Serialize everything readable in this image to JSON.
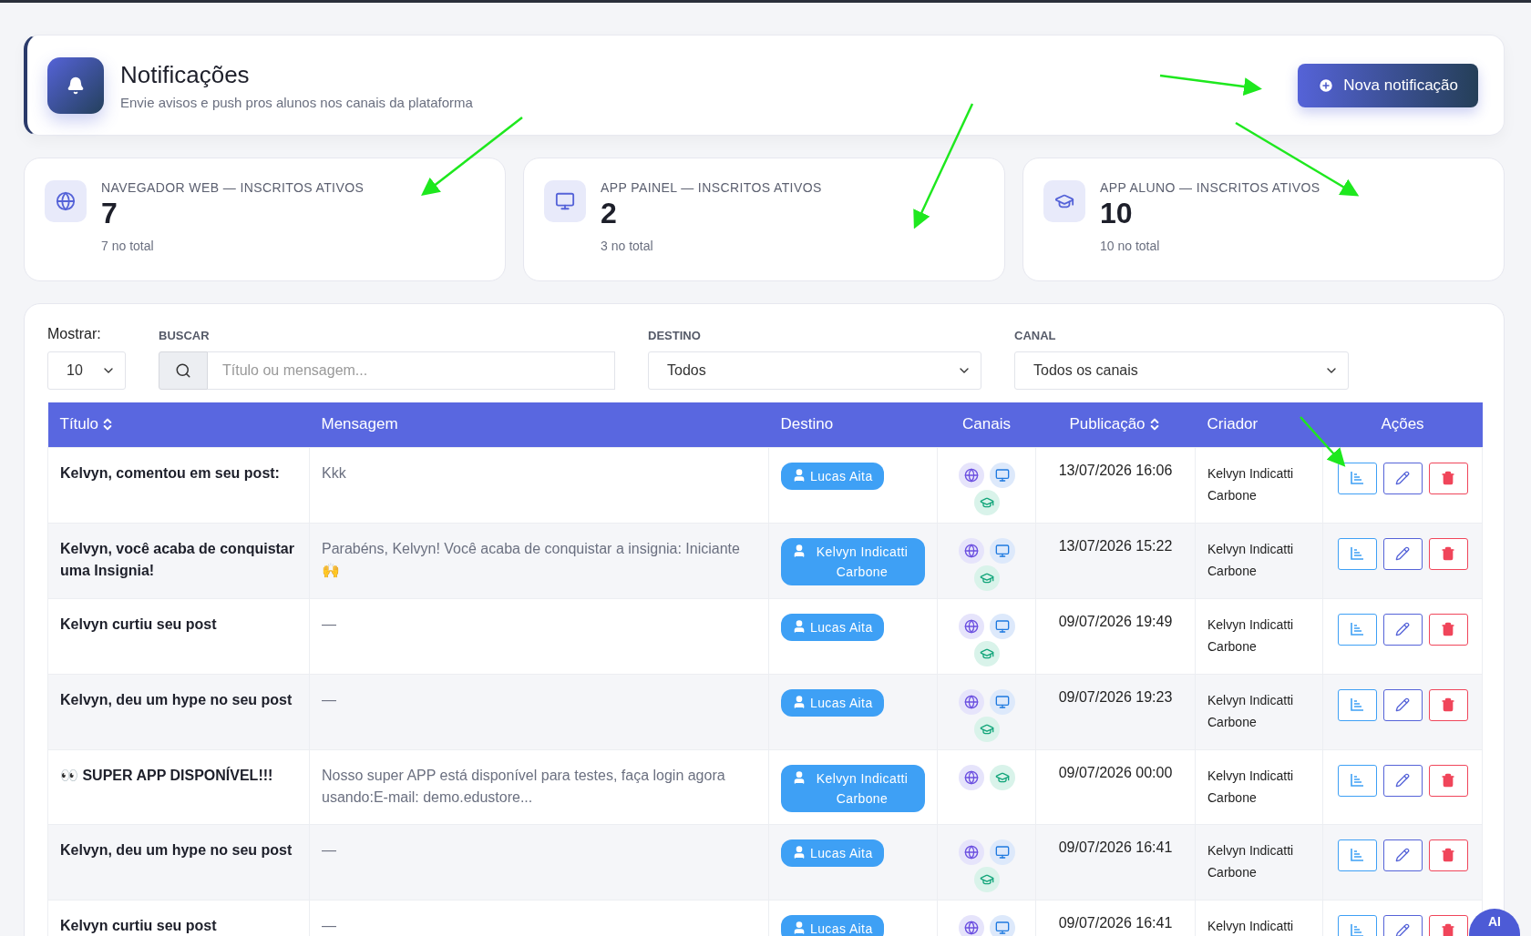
{
  "header": {
    "title": "Notificações",
    "subtitle": "Envie avisos e push pros alunos nos canais da plataforma",
    "button": "Nova notificação"
  },
  "stats": [
    {
      "kind": "web",
      "label": "NAVEGADOR WEB — INSCRITOS ATIVOS",
      "value": "7",
      "total": "7 no total"
    },
    {
      "kind": "painel",
      "label": "APP PAINEL — INSCRITOS ATIVOS",
      "value": "2",
      "total": "3 no total"
    },
    {
      "kind": "aluno",
      "label": "APP ALUNO — INSCRITOS ATIVOS",
      "value": "10",
      "total": "10 no total"
    }
  ],
  "filters": {
    "show_label": "Mostrar:",
    "show_value": "10",
    "search_label": "BUSCAR",
    "search_placeholder": "Título ou mensagem...",
    "destino_label": "DESTINO",
    "destino_value": "Todos",
    "canal_label": "CANAL",
    "canal_value": "Todos os canais"
  },
  "table": {
    "columns": [
      {
        "label": "Título",
        "sortable": true
      },
      {
        "label": "Mensagem",
        "sortable": false
      },
      {
        "label": "Destino",
        "sortable": false
      },
      {
        "label": "Canais",
        "sortable": false
      },
      {
        "label": "Publicação",
        "sortable": true
      },
      {
        "label": "Criador",
        "sortable": false
      },
      {
        "label": "Ações",
        "sortable": false
      }
    ],
    "rows": [
      {
        "title": "Kelvyn, comentou em seu post:",
        "message": "Kkk",
        "destination": "Lucas Aita",
        "channels": [
          {
            "kind": "web"
          },
          {
            "kind": "painel"
          },
          {
            "kind": "aluno"
          }
        ],
        "date": "13/07/2026 16:06",
        "creator": "Kelvyn Indicatti Carbone"
      },
      {
        "title": "Kelvyn, você acaba de conquistar uma Insignia!",
        "message": "Parabéns, Kelvyn! Você acaba de conquistar a insignia: Iniciante 🙌",
        "destination": "Kelvyn Indicatti Carbone",
        "channels": [
          {
            "kind": "web"
          },
          {
            "kind": "painel"
          },
          {
            "kind": "aluno"
          }
        ],
        "date": "13/07/2026 15:22",
        "creator": "Kelvyn Indicatti Carbone"
      },
      {
        "title": "Kelvyn curtiu seu post",
        "message": "—",
        "destination": "Lucas Aita",
        "channels": [
          {
            "kind": "web"
          },
          {
            "kind": "painel"
          },
          {
            "kind": "aluno"
          }
        ],
        "date": "09/07/2026 19:49",
        "creator": "Kelvyn Indicatti Carbone"
      },
      {
        "title": "Kelvyn, deu um hype no seu post",
        "message": "—",
        "destination": "Lucas Aita",
        "channels": [
          {
            "kind": "web"
          },
          {
            "kind": "painel"
          },
          {
            "kind": "aluno"
          }
        ],
        "date": "09/07/2026 19:23",
        "creator": "Kelvyn Indicatti Carbone"
      },
      {
        "title": "👀 SUPER APP DISPONÍVEL!!!",
        "message": "Nosso super APP está disponível para testes, faça login agora usando:E-mail: demo.edustore...",
        "destination": "Kelvyn Indicatti Carbone",
        "channels": [
          {
            "kind": "web"
          },
          {
            "kind": "aluno"
          }
        ],
        "date": "09/07/2026 00:00",
        "creator": "Kelvyn Indicatti Carbone"
      },
      {
        "title": "Kelvyn, deu um hype no seu post",
        "message": "—",
        "destination": "Lucas Aita",
        "channels": [
          {
            "kind": "web"
          },
          {
            "kind": "painel"
          },
          {
            "kind": "aluno"
          }
        ],
        "date": "09/07/2026 16:41",
        "creator": "Kelvyn Indicatti Carbone"
      },
      {
        "title": "Kelvyn curtiu seu post",
        "message": "—",
        "destination": "Lucas Aita",
        "channels": [
          {
            "kind": "web"
          },
          {
            "kind": "painel"
          }
        ],
        "date": "09/07/2026 16:41",
        "creator": "Kelvyn Indicatti"
      }
    ]
  },
  "ai_button": {
    "label": "AI"
  }
}
